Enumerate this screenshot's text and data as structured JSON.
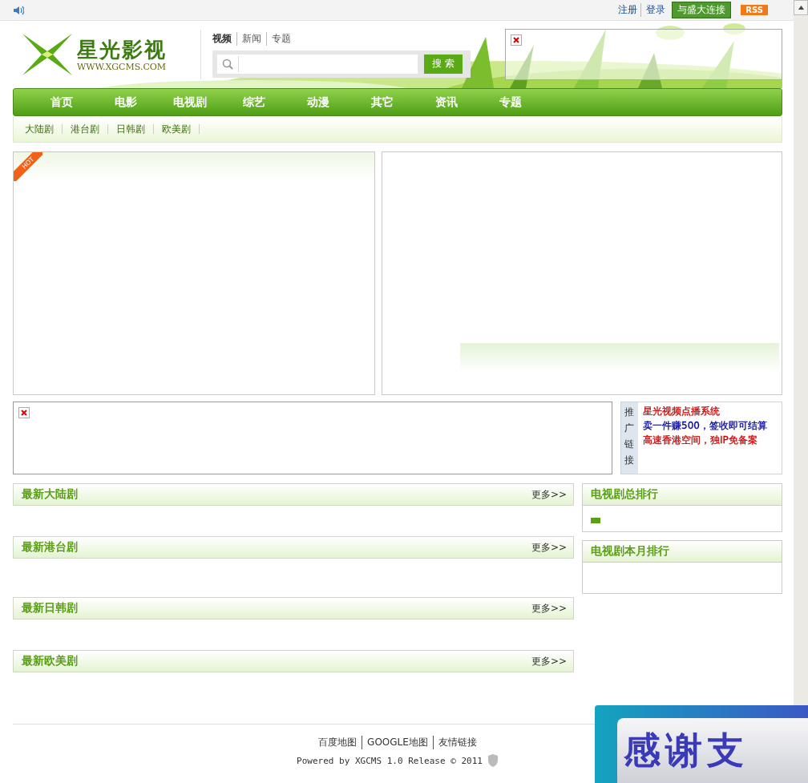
{
  "top_bar": {
    "links": [
      "注册",
      "登录"
    ],
    "connect_button": "与盛大连接",
    "rss": "RSS"
  },
  "logo": {
    "title": "星光影视",
    "url": "WWW.XGCMS.COM"
  },
  "search": {
    "tabs": [
      {
        "label": "视频",
        "selected": true
      },
      {
        "label": "新闻",
        "selected": false
      },
      {
        "label": "专题",
        "selected": false
      }
    ],
    "button": "搜 索"
  },
  "nav": [
    "首页",
    "电影",
    "电视剧",
    "综艺",
    "动漫",
    "其它",
    "资讯",
    "专题"
  ],
  "subnav": [
    "大陆剧",
    "港台剧",
    "日韩剧",
    "欧美剧"
  ],
  "hot_badge": "HOT",
  "promo": {
    "label": "推广链接",
    "links": [
      {
        "text": "星光视频点播系统",
        "color": "#cc0000"
      },
      {
        "text": "卖一件赚500，签收即可结算",
        "color": "#000099"
      },
      {
        "text": "高速香港空间，独IP免备案",
        "color": "#cc0000"
      }
    ]
  },
  "sections": [
    {
      "title": "最新大陆剧",
      "more": "更多>>"
    },
    {
      "title": "最新港台剧",
      "more": "更多>>"
    },
    {
      "title": "最新日韩剧",
      "more": "更多>>"
    },
    {
      "title": "最新欧美剧",
      "more": "更多>>"
    }
  ],
  "rankings": [
    {
      "title": "电视剧总排行",
      "has_item": true
    },
    {
      "title": "电视剧本月排行",
      "has_item": false
    }
  ],
  "footer": {
    "links": [
      "百度地图",
      "GOOGLE地图",
      "友情链接"
    ],
    "powered": "Powered by XGCMS 1.0 Release © 2011"
  },
  "float_ad": {
    "text": "感谢支"
  }
}
